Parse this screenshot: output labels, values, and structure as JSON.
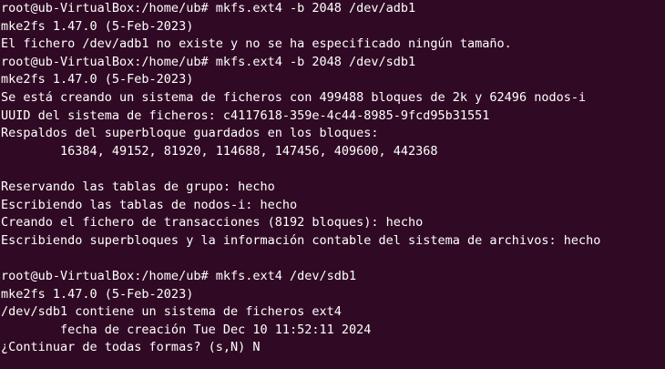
{
  "terminal": {
    "lines": [
      "root@ub-VirtualBox:/home/ub# mkfs.ext4 -b 2048 /dev/adb1",
      "mke2fs 1.47.0 (5-Feb-2023)",
      "El fichero /dev/adb1 no existe y no se ha especificado ningún tamaño.",
      "root@ub-VirtualBox:/home/ub# mkfs.ext4 -b 2048 /dev/sdb1",
      "mke2fs 1.47.0 (5-Feb-2023)",
      "Se está creando un sistema de ficheros con 499488 bloques de 2k y 62496 nodos-i",
      "UUID del sistema de ficheros: c4117618-359e-4c44-8985-9fcd95b31551",
      "Respaldos del superbloque guardados en los bloques:",
      "        16384, 49152, 81920, 114688, 147456, 409600, 442368",
      "",
      "Reservando las tablas de grupo: hecho",
      "Escribiendo las tablas de nodos-i: hecho",
      "Creando el fichero de transacciones (8192 bloques): hecho",
      "Escribiendo superbloques y la información contable del sistema de archivos: hecho",
      "",
      "root@ub-VirtualBox:/home/ub# mkfs.ext4 /dev/sdb1",
      "mke2fs 1.47.0 (5-Feb-2023)",
      "/dev/sdb1 contiene un sistema de ficheros ext4",
      "        fecha de creación Tue Dec 10 11:52:11 2024",
      "¿Continuar de todas formas? (s,N) N"
    ]
  }
}
